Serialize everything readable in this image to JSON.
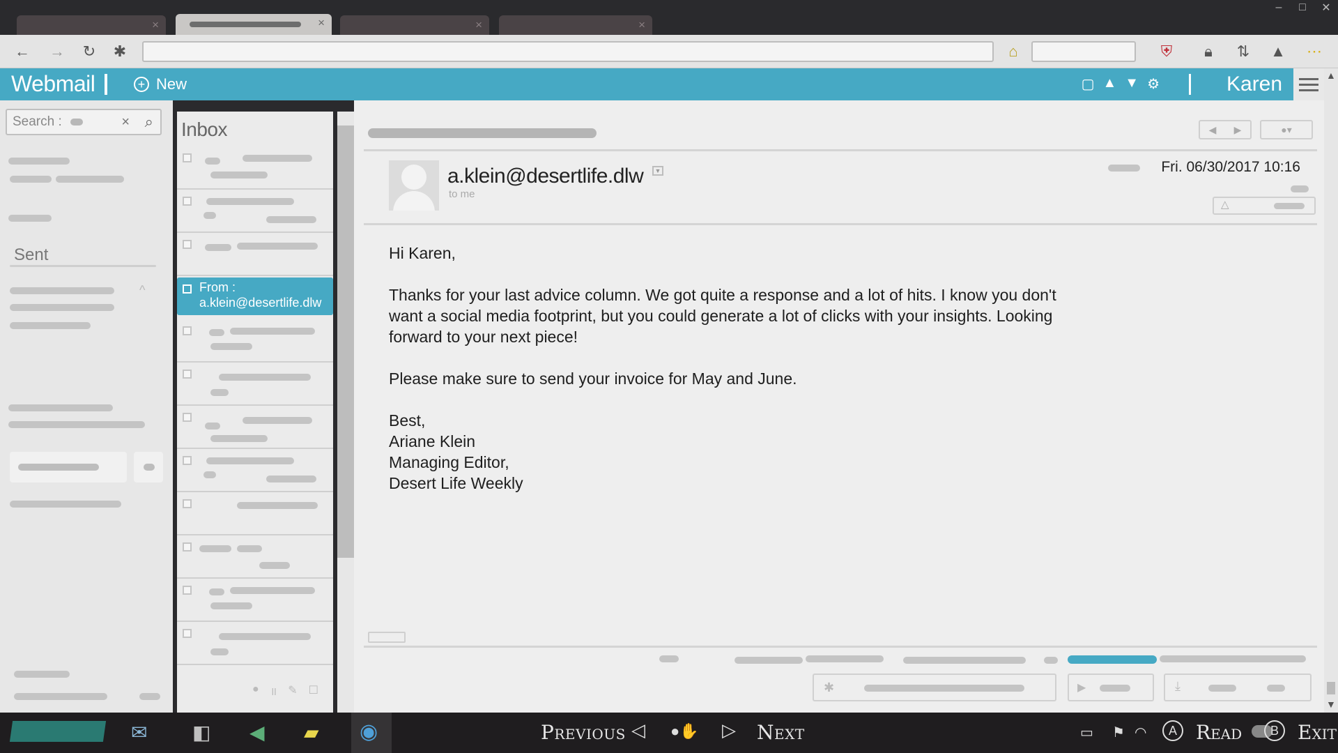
{
  "app": {
    "brand": "Webmail",
    "new_label": "New",
    "user": "Karen"
  },
  "search": {
    "label": "Search :"
  },
  "folders": {
    "sent": "Sent"
  },
  "list": {
    "title": "Inbox",
    "selected_from_label": "From :",
    "selected_from_address": "a.klein@desertlife.dlw"
  },
  "message": {
    "sender": "a.klein@desertlife.dlw",
    "to": "to me",
    "date": "Fri. 06/30/2017 10:16",
    "greeting": "Hi Karen,",
    "para1": "Thanks for your last advice column. We got quite a response and a lot of hits. I know you don't want a social media footprint, but you could generate a lot of clicks with your insights. Looking forward to your next piece!",
    "para2": "Please make sure to send your invoice for May and June.",
    "sig_line1": "Best,",
    "sig_line2": "Ariane Klein",
    "sig_line3": "Managing Editor,",
    "sig_line4": "Desert Life Weekly"
  },
  "taskbar": {
    "previous": "Previous",
    "next": "Next",
    "read": "Read",
    "exit": "Exit",
    "read_button_glyph": "A",
    "exit_button_glyph": "B"
  },
  "colors": {
    "accent": "#46a9c4",
    "taskbar": "#1f1d1f",
    "titlebar": "#2a2a2d"
  }
}
